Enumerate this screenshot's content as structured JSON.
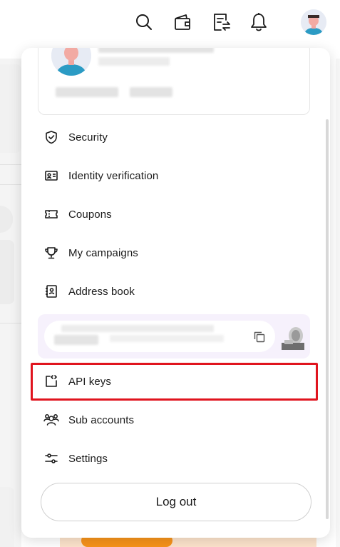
{
  "header": {
    "icons": [
      "search-icon",
      "wallet-icon",
      "orders-icon",
      "bell-icon",
      "avatar"
    ]
  },
  "menu": {
    "items": [
      {
        "label": "Security",
        "icon": "shield-icon"
      },
      {
        "label": "Identity verification",
        "icon": "id-card-icon"
      },
      {
        "label": "Coupons",
        "icon": "ticket-icon"
      },
      {
        "label": "My campaigns",
        "icon": "trophy-icon"
      },
      {
        "label": "Address book",
        "icon": "address-book-icon"
      },
      {
        "label": "API keys",
        "icon": "api-code-icon"
      },
      {
        "label": "Sub accounts",
        "icon": "users-icon"
      },
      {
        "label": "Settings",
        "icon": "sliders-icon"
      }
    ],
    "logout_label": "Log out"
  },
  "colors": {
    "highlight": "#e0141e",
    "uid_background": "#f6f1fc",
    "accent_orange": "#f7931a"
  }
}
